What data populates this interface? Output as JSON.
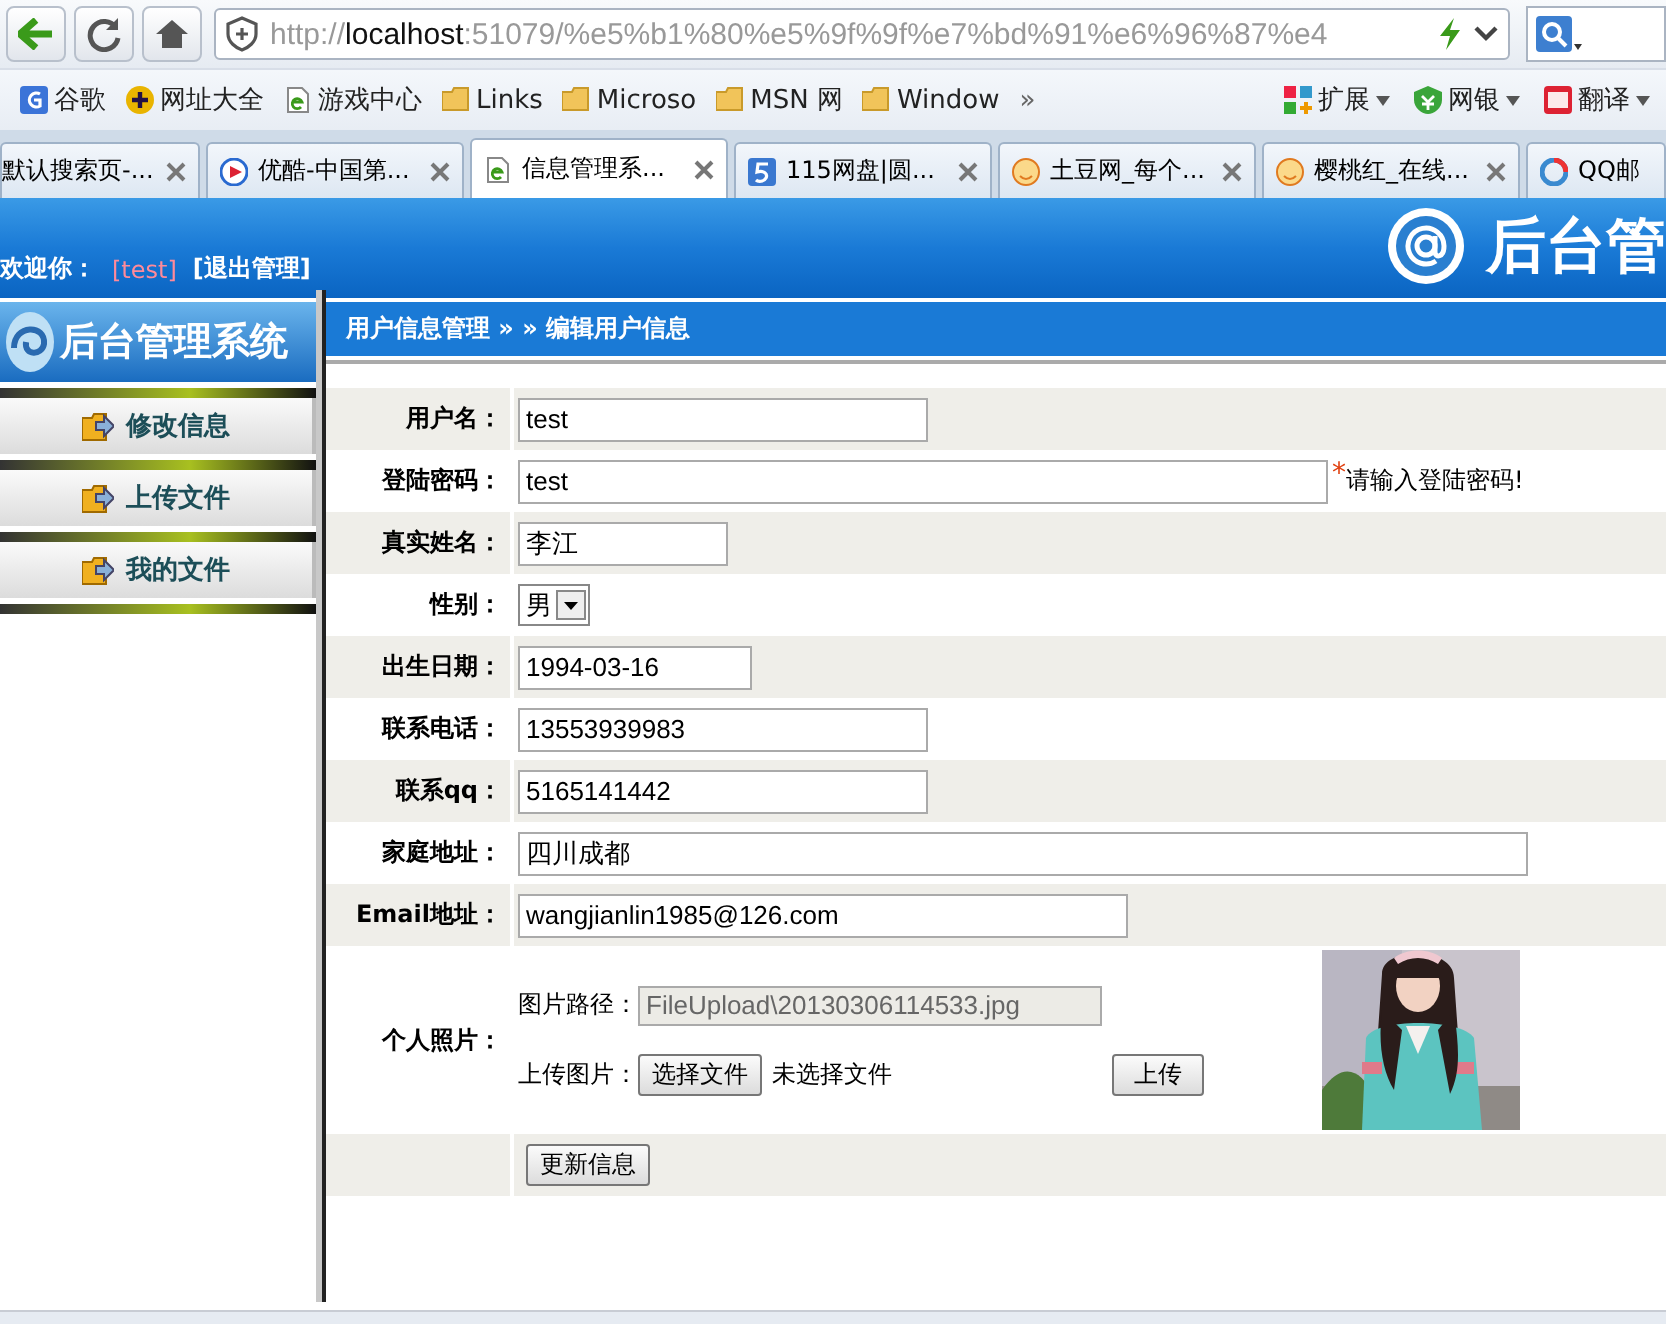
{
  "browser": {
    "address": "http://localhost:51079/%e5%b1%80%e5%9f%9f%e7%bd%91%e6%96%87%e4",
    "bookmarks": [
      {
        "label": "谷歌",
        "kind": "google"
      },
      {
        "label": "网址大全",
        "kind": "plus"
      },
      {
        "label": "游戏中心",
        "kind": "page"
      },
      {
        "label": "Links",
        "kind": "folder"
      },
      {
        "label": "Microso",
        "kind": "folder"
      },
      {
        "label": "MSN 网",
        "kind": "folder"
      },
      {
        "label": "Window",
        "kind": "folder"
      }
    ],
    "more": "»",
    "tools": [
      {
        "label": "扩展",
        "kind": "apps"
      },
      {
        "label": "网银",
        "kind": "shield"
      },
      {
        "label": "翻译",
        "kind": "dict"
      }
    ],
    "tabs": [
      {
        "label": "默认搜索页-...",
        "selected": false,
        "kind": "none"
      },
      {
        "label": "优酷-中国第...",
        "selected": false,
        "kind": "play"
      },
      {
        "label": "信息管理系...",
        "selected": true,
        "kind": "page"
      },
      {
        "label": "115网盘|圆...",
        "selected": false,
        "kind": "five"
      },
      {
        "label": "土豆网_每个...",
        "selected": false,
        "kind": "smile"
      },
      {
        "label": "樱桃红_在线...",
        "selected": false,
        "kind": "smile"
      },
      {
        "label": "QQ邮",
        "selected": false,
        "kind": "ring"
      }
    ]
  },
  "header": {
    "welcome": "欢迎你：",
    "user": "[test]",
    "logout": "[退出管理]",
    "logo": "后台管"
  },
  "sidebar": {
    "logo": "后台管理系统",
    "items": [
      "修改信息",
      "上传文件",
      "我的文件"
    ]
  },
  "breadcrumb": "用户信息管理 » » 编辑用户信息",
  "form": {
    "rows": [
      {
        "kind": "text",
        "label": "用户名：",
        "value": "test"
      },
      {
        "kind": "text",
        "label": "登陆密码：",
        "value": "test",
        "required_mark": "*",
        "note": "请输入登陆密码!"
      },
      {
        "kind": "text",
        "label": "真实姓名：",
        "value": "李江"
      },
      {
        "kind": "select",
        "label": "性别：",
        "value": "男"
      },
      {
        "kind": "text",
        "label": "出生日期：",
        "value": "1994-03-16"
      },
      {
        "kind": "text",
        "label": "联系电话：",
        "value": "13553939983"
      },
      {
        "kind": "text",
        "label": "联系qq：",
        "value": "5165141442"
      },
      {
        "kind": "text",
        "label": "家庭地址：",
        "value": "四川成都"
      },
      {
        "kind": "text",
        "label": "Email地址：",
        "value": "wangjianlin1985@126.com"
      },
      {
        "label": "个人照片：",
        "path_label": "图片路径：",
        "path_value": "FileUpload\\20130306114533.jpg",
        "path_disabled": true,
        "upload_label": "上传图片：",
        "choose_button": "选择文件",
        "file_status": "未选择文件",
        "upload_button": "上传"
      }
    ],
    "submit": "更新信息"
  }
}
